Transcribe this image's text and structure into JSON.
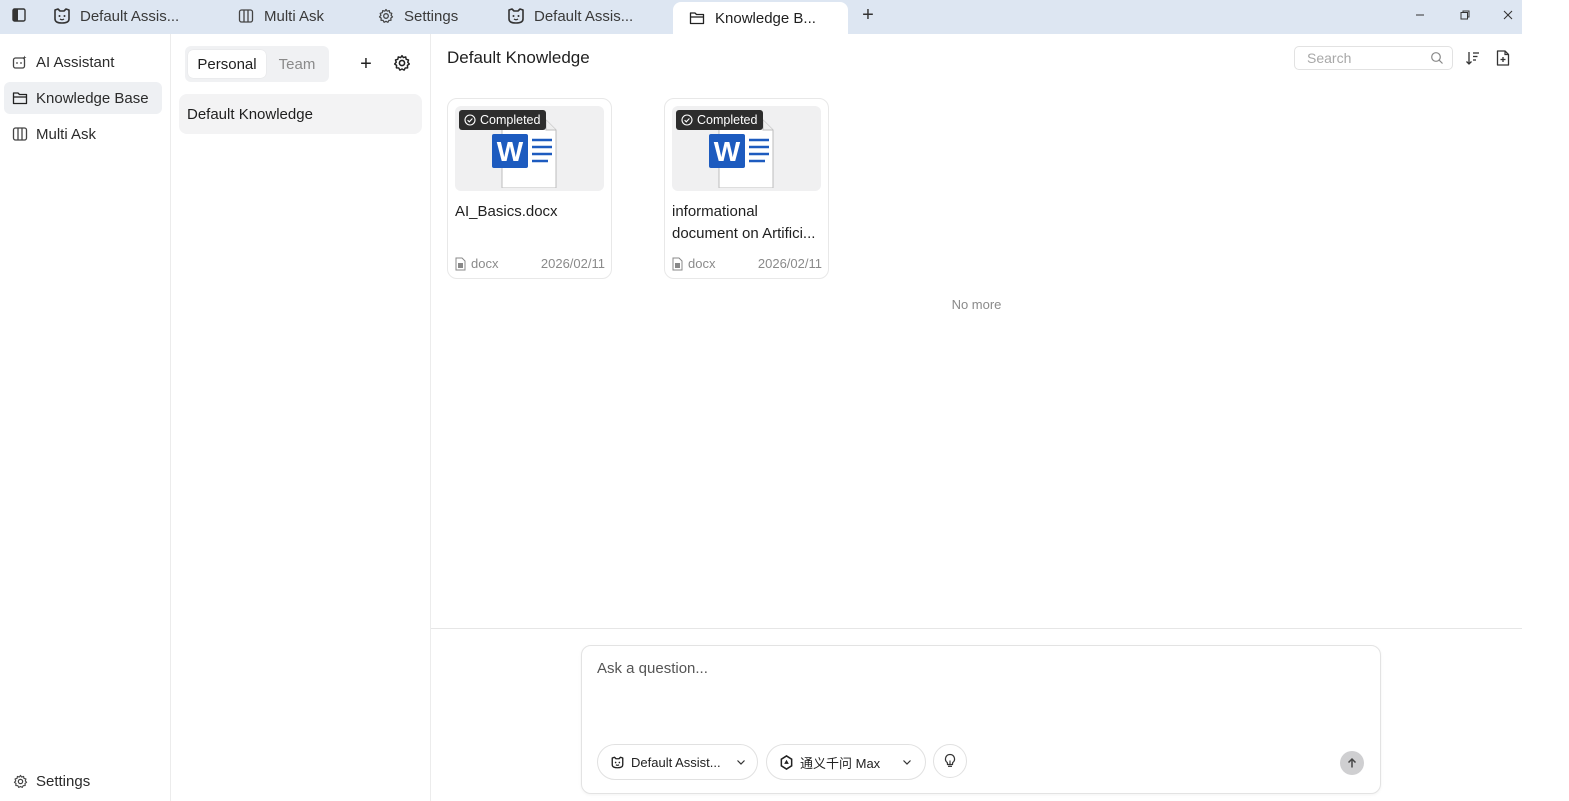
{
  "tabs": [
    {
      "label": "Default Assis...",
      "icon": "assistant-face-icon",
      "active": false
    },
    {
      "label": "Multi Ask",
      "icon": "columns-icon",
      "active": false
    },
    {
      "label": "Settings",
      "icon": "gear-icon",
      "active": false
    },
    {
      "label": "Default Assis...",
      "icon": "assistant-face-icon",
      "active": false
    },
    {
      "label": "Knowledge B...",
      "icon": "folder-icon",
      "active": true
    }
  ],
  "newtab_label": "+",
  "nav": {
    "items": [
      {
        "label": "AI Assistant",
        "icon": "assistant-icon",
        "active": false
      },
      {
        "label": "Knowledge Base",
        "icon": "folder-icon",
        "active": true
      },
      {
        "label": "Multi Ask",
        "icon": "columns-icon",
        "active": false
      }
    ],
    "settings_label": "Settings"
  },
  "kb_panel": {
    "segments": [
      "Personal",
      "Team"
    ],
    "selected_segment": "Personal",
    "add_label": "+",
    "items": [
      "Default Knowledge"
    ]
  },
  "main": {
    "title": "Default Knowledge",
    "search_placeholder": "Search",
    "files": [
      {
        "status": "Completed",
        "name": "AI_Basics.docx",
        "type": "docx",
        "date": "2026/02/11"
      },
      {
        "status": "Completed",
        "name": "informational document on Artifici...",
        "type": "docx",
        "date": "2026/02/11"
      }
    ],
    "no_more": "No more"
  },
  "composer": {
    "placeholder": "Ask a question...",
    "assistant_label": "Default Assist...",
    "model_label": "通义千问 Max"
  },
  "colors": {
    "titlebar_bg": "#dde6f2",
    "word_blue": "#1d5bbf",
    "badge_bg": "#2d2d2d"
  }
}
